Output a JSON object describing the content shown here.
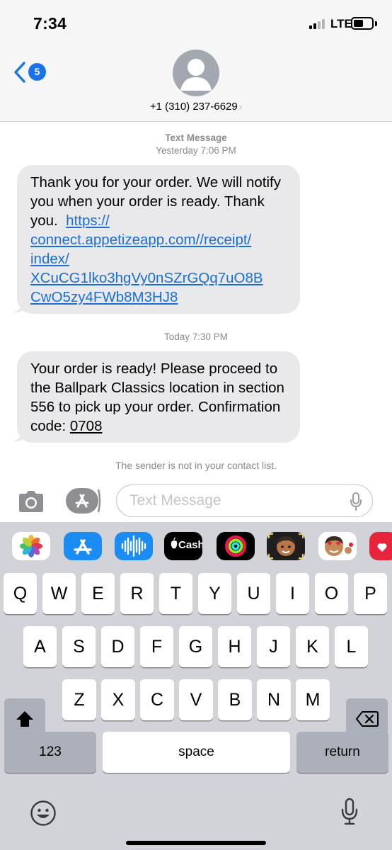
{
  "status": {
    "time": "7:34",
    "network": "LTE",
    "battery_level": 0.55
  },
  "header": {
    "back_badge_count": "5",
    "contact_number": "+1 (310) 237-6629",
    "chevron": "›"
  },
  "messages": [
    {
      "timestamp_type": "Text Message",
      "timestamp_time": "Yesterday 7:06 PM",
      "text_before_link": "Thank you for your order. We will notify you when your order is ready. Thank you.",
      "link_lines": [
        "https://",
        "connect.appetizeapp.com//receipt/",
        "index/",
        "XCuCG1lko3hgVy0nSZrGQq7uO8B",
        "CwO5zy4FWb8M3HJ8"
      ]
    },
    {
      "timestamp_time": "Today 7:30 PM",
      "text": "Your order is ready! Please proceed to the Ballpark Classics location in section 556 to pick up your order. Confirmation code:",
      "code": "0708"
    }
  ],
  "notice": "The sender is not in your contact list.",
  "compose": {
    "placeholder": "Text Message"
  },
  "app_drawer": [
    {
      "name": "photos-icon"
    },
    {
      "name": "app-store-icon"
    },
    {
      "name": "audio-message-icon"
    },
    {
      "name": "apple-cash-icon",
      "label": "Cash"
    },
    {
      "name": "activity-icon"
    },
    {
      "name": "memoji-icon"
    },
    {
      "name": "memoji-stickers-icon"
    },
    {
      "name": "digital-touch-icon"
    }
  ],
  "keyboard": {
    "row1": [
      "Q",
      "W",
      "E",
      "R",
      "T",
      "Y",
      "U",
      "I",
      "O",
      "P"
    ],
    "row2": [
      "A",
      "S",
      "D",
      "F",
      "G",
      "H",
      "J",
      "K",
      "L"
    ],
    "row3": [
      "Z",
      "X",
      "C",
      "V",
      "B",
      "N",
      "M"
    ],
    "numbers_label": "123",
    "space_label": "space",
    "return_label": "return"
  },
  "colors": {
    "link": "#1a6fd6",
    "badge": "#1a73e8",
    "bubble": "#e9e9eb",
    "keyboard_bg": "#d1d3d9"
  }
}
